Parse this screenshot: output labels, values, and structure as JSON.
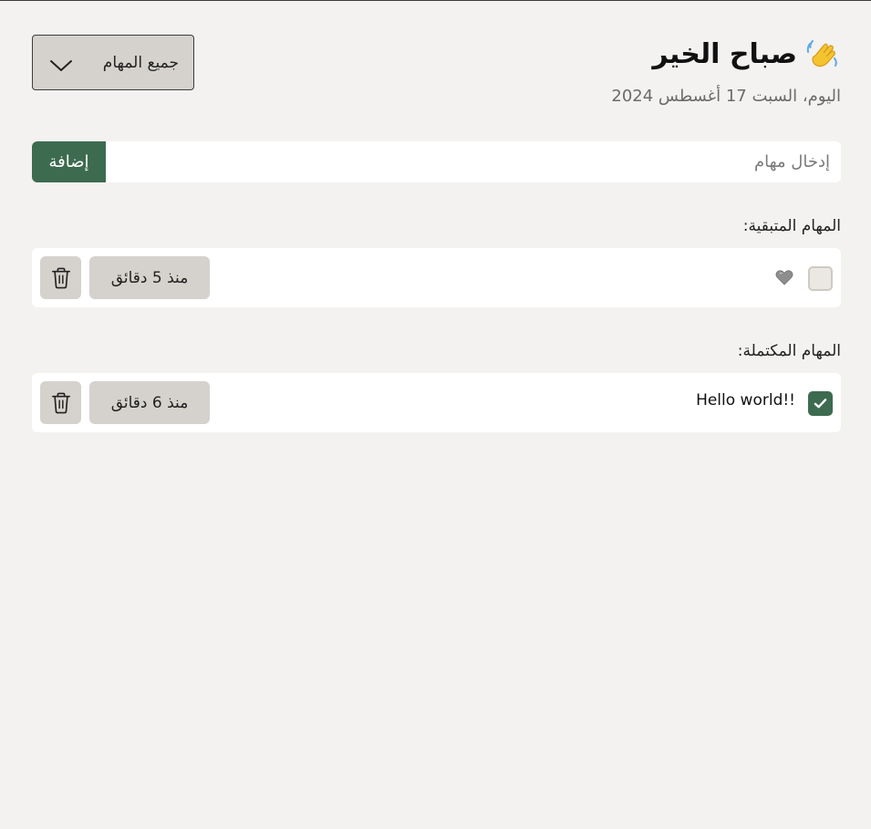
{
  "header": {
    "greeting": "صباح الخير",
    "date": "اليوم، السبت 17 أغسطس 2024",
    "wave_icon": "waving-hand-icon"
  },
  "filter": {
    "selected": "جميع المهام",
    "icon": "chevron-down-icon"
  },
  "add_form": {
    "placeholder": "إدخال مهام",
    "value": "",
    "button_label": "إضافة"
  },
  "pending": {
    "label": "المهام المتبقية:",
    "items": [
      {
        "text": "",
        "time": "منذ 5 دقائق",
        "done": false,
        "marker_icon": "heart-icon"
      }
    ]
  },
  "completed": {
    "label": "المهام المكتملة:",
    "items": [
      {
        "text": "Hello world!!",
        "time": "منذ 6 دقائق",
        "done": true
      }
    ]
  },
  "colors": {
    "background": "#f3f2f0",
    "accent": "#3d6b4f",
    "button_bg": "#d5d2cd",
    "card_bg": "#ffffff"
  }
}
